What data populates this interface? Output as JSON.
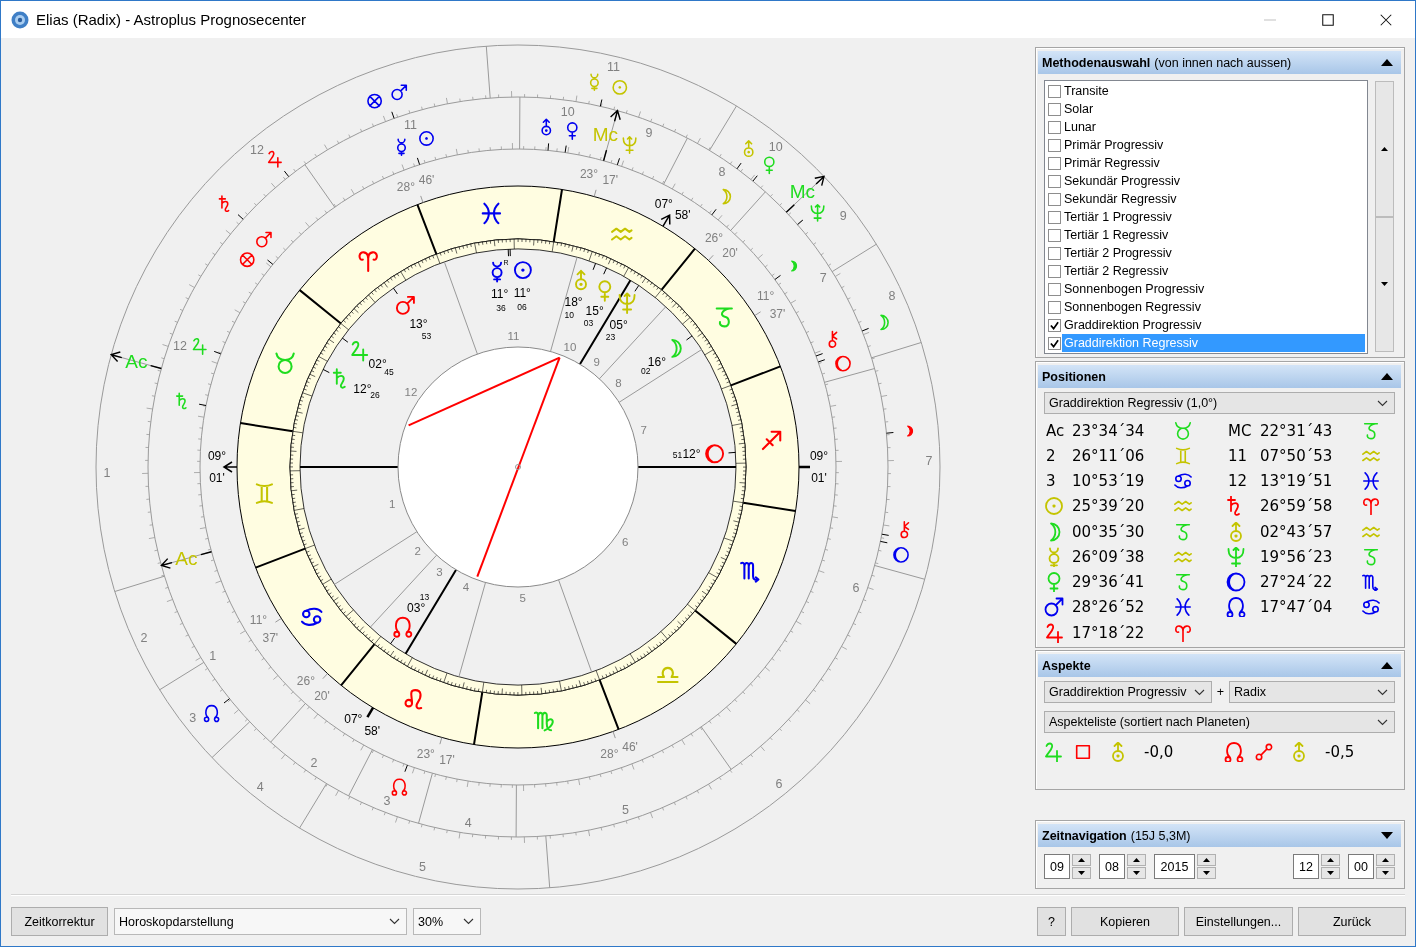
{
  "window": {
    "title": "Elias (Radix) - Astroplus Prognosecenter",
    "controls": [
      {
        "kind": "minimize",
        "disabled": true
      },
      {
        "kind": "maximize",
        "disabled": false
      },
      {
        "kind": "close",
        "disabled": false
      }
    ]
  },
  "wheel": {
    "signs": [
      {
        "kind": "aries",
        "color": "#ff0000"
      },
      {
        "kind": "taurus",
        "color": "#1fdc1f"
      },
      {
        "kind": "gemini",
        "color": "#c4c400"
      },
      {
        "kind": "cancer",
        "color": "#0000f0"
      },
      {
        "kind": "leo",
        "color": "#ff0000"
      },
      {
        "kind": "virgo",
        "color": "#1fdc1f"
      },
      {
        "kind": "libra",
        "color": "#c4c400"
      },
      {
        "kind": "scorpio",
        "color": "#0000f0"
      },
      {
        "kind": "sagittarius",
        "color": "#ff0000"
      },
      {
        "kind": "capricorn",
        "color": "#1fdc1f"
      },
      {
        "kind": "aquarius",
        "color": "#c4c400"
      },
      {
        "kind": "pisces",
        "color": "#0000f0"
      }
    ],
    "cusps": [
      {
        "kind": "cusp",
        "sign": {
          "kind": "pisces"
        },
        "degree": "28°",
        "minute": "46'"
      },
      {
        "kind": "cusp",
        "sign": {
          "kind": "aquarius"
        },
        "degree": "23°",
        "minute": "17'"
      },
      {
        "kind": "mc",
        "sign": {
          "kind": "aquarius"
        },
        "degree": "07°",
        "minute": "58'"
      },
      {
        "kind": "cusp",
        "sign": {
          "kind": "capricorn"
        },
        "degree": "26°",
        "minute": "20'"
      },
      {
        "kind": "cusp",
        "sign": {
          "kind": "capricorn"
        },
        "degree": "11°",
        "minute": "37'"
      },
      {
        "kind": "ac",
        "sign": {
          "kind": "gemini"
        },
        "degree": "09°",
        "minute": "01'"
      },
      {
        "kind": "dc",
        "sign": {
          "kind": "sagittarius"
        },
        "degree": "09°",
        "minute": "01'"
      },
      {
        "kind": "cusp",
        "sign": {
          "kind": "cancer"
        },
        "degree": "11°",
        "minute": "37'"
      },
      {
        "kind": "cusp",
        "sign": {
          "kind": "cancer"
        },
        "degree": "26°",
        "minute": "20'"
      },
      {
        "kind": "ic",
        "sign": {
          "kind": "leo"
        },
        "degree": "07°",
        "minute": "58'"
      },
      {
        "kind": "cusp",
        "sign": {
          "kind": "leo"
        },
        "degree": "23°",
        "minute": "17'"
      },
      {
        "kind": "cusp",
        "sign": {
          "kind": "virgo"
        },
        "degree": "28°",
        "minute": "46'"
      }
    ],
    "house_numbers": [
      "1",
      "2",
      "3",
      "4",
      "5",
      "6",
      "7",
      "8",
      "9",
      "10",
      "11",
      "12"
    ],
    "planets": [
      {
        "kind": "mercury",
        "sign": {
          "kind": "pisces"
        },
        "degree": "11°",
        "minute": "36",
        "retrograde": "R",
        "color": "#0000f0"
      },
      {
        "kind": "sun",
        "sign": {
          "kind": "pisces"
        },
        "degree": "11°",
        "minute": "06",
        "color": "#0000f0"
      },
      {
        "kind": "uranus",
        "sign": {
          "kind": "aquarius"
        },
        "degree": "18°",
        "minute": "10",
        "color": "#c4c400"
      },
      {
        "kind": "venus",
        "sign": {
          "kind": "aquarius"
        },
        "degree": "15°",
        "minute": "03",
        "color": "#c4c400"
      },
      {
        "kind": "mars",
        "sign": {
          "kind": "aries"
        },
        "degree": "13°",
        "minute": "53",
        "color": "#ff0000"
      },
      {
        "kind": "neptune",
        "sign": {
          "kind": "aquarius"
        },
        "degree": "05°",
        "minute": "23",
        "color": "#c4c400"
      },
      {
        "kind": "jupiter",
        "sign": {
          "kind": "taurus"
        },
        "degree": "02°",
        "minute": "45",
        "color": "#1fdc1f"
      },
      {
        "kind": "moon",
        "sign": {
          "kind": "capricorn"
        },
        "degree": "16°",
        "minute": "02",
        "color": "#1fdc1f"
      },
      {
        "kind": "saturn",
        "sign": {
          "kind": "taurus"
        },
        "degree": "12°",
        "minute": "26",
        "color": "#1fdc1f"
      },
      {
        "kind": "ringed_moon",
        "sign": {
          "kind": "sagittarius"
        },
        "degree": "12°",
        "minute": "51",
        "color": "#ff0000"
      },
      {
        "kind": "node",
        "sign": {
          "kind": "leo"
        },
        "degree": "03°",
        "minute": "13",
        "color": "#ff0000"
      }
    ],
    "rings": [
      {
        "houses": [
          "1",
          "2",
          "3",
          "4",
          "5",
          "6",
          "7",
          "8",
          "9",
          "10",
          "11",
          "12"
        ],
        "axes": [
          {
            "kind": "ac",
            "label": "Ac",
            "color": "#c4c400"
          },
          {
            "kind": "mc",
            "label": "Mc",
            "color": "#c4c400"
          }
        ],
        "points": [
          {
            "kind": "fortune",
            "color": "#ff0000"
          },
          {
            "kind": "mars",
            "color": "#ff0000"
          },
          {
            "kind": "jupiter",
            "color": "#1fdc1f"
          },
          {
            "kind": "saturn",
            "color": "#1fdc1f"
          },
          {
            "kind": "mercury",
            "color": "#0000f0"
          },
          {
            "kind": "sun",
            "color": "#0000f0"
          },
          {
            "kind": "uranus",
            "color": "#0000f0"
          },
          {
            "kind": "venus",
            "color": "#0000f0"
          },
          {
            "kind": "neptune",
            "color": "#c4c400"
          },
          {
            "kind": "moon",
            "color": "#c4c400"
          },
          {
            "kind": "small_moon",
            "color": "#1fdc1f"
          },
          {
            "kind": "chiron",
            "color": "#ff0000"
          },
          {
            "kind": "ringed_moon",
            "color": "#ff0000"
          },
          {
            "kind": "node",
            "color": "#ff0000"
          }
        ]
      },
      {
        "houses": [
          "1",
          "2",
          "3",
          "4",
          "5",
          "6",
          "7",
          "8",
          "9",
          "10",
          "11",
          "12"
        ],
        "axes": [
          {
            "kind": "ac",
            "label": "Ac",
            "color": "#1fdc1f"
          },
          {
            "kind": "mc",
            "label": "Mc",
            "color": "#1fdc1f"
          }
        ],
        "points": [
          {
            "kind": "fortune",
            "color": "#0000f0"
          },
          {
            "kind": "mars",
            "color": "#0000f0"
          },
          {
            "kind": "jupiter",
            "color": "#ff0000"
          },
          {
            "kind": "saturn",
            "color": "#ff0000"
          },
          {
            "kind": "mercury",
            "color": "#c4c400"
          },
          {
            "kind": "sun",
            "color": "#c4c400"
          },
          {
            "kind": "uranus",
            "color": "#c4c400"
          },
          {
            "kind": "venus",
            "color": "#1fdc1f"
          },
          {
            "kind": "neptune",
            "color": "#1fdc1f"
          },
          {
            "kind": "moon",
            "color": "#1fdc1f"
          },
          {
            "kind": "small_moon",
            "color": "#ff0000"
          },
          {
            "kind": "chiron",
            "color": "#ff0000"
          },
          {
            "kind": "ringed_moon",
            "color": "#0000f0"
          },
          {
            "kind": "node",
            "color": "#0000f0"
          }
        ]
      }
    ]
  },
  "methods": {
    "title": "Methodenauswahl",
    "detail": "(von innen nach aussen)",
    "expanded": true,
    "items": [
      {
        "label": "Transite",
        "checked": false,
        "selected": false
      },
      {
        "label": "Solar",
        "checked": false,
        "selected": false
      },
      {
        "label": "Lunar",
        "checked": false,
        "selected": false
      },
      {
        "label": "Primär Progressiv",
        "checked": false,
        "selected": false
      },
      {
        "label": "Primär Regressiv",
        "checked": false,
        "selected": false
      },
      {
        "label": "Sekundär Progressiv",
        "checked": false,
        "selected": false
      },
      {
        "label": "Sekundär Regressiv",
        "checked": false,
        "selected": false
      },
      {
        "label": "Tertiär 1 Progressiv",
        "checked": false,
        "selected": false
      },
      {
        "label": "Tertiär 1 Regressiv",
        "checked": false,
        "selected": false
      },
      {
        "label": "Tertiär 2 Progressiv",
        "checked": false,
        "selected": false
      },
      {
        "label": "Tertiär 2 Regressiv",
        "checked": false,
        "selected": false
      },
      {
        "label": "Sonnenbogen Progressiv",
        "checked": false,
        "selected": false
      },
      {
        "label": "Sonnenbogen Regressiv",
        "checked": false,
        "selected": false
      },
      {
        "label": "Graddirektion Progressiv",
        "checked": true,
        "selected": false
      },
      {
        "label": "Graddirektion Regressiv",
        "checked": true,
        "selected": true
      }
    ]
  },
  "positions": {
    "title": "Positionen",
    "expanded": true,
    "method": "Graddirektion Regressiv (1,0°)",
    "columns": [
      [
        {
          "cells": [
            {
              "kind": "text",
              "text": "Ac"
            },
            {
              "kind": "text",
              "text": "23°34´34"
            },
            {
              "kind": "taurus",
              "color": "#1fdc1f"
            }
          ]
        },
        {
          "cells": [
            {
              "kind": "text",
              "text": "2"
            },
            {
              "kind": "text",
              "text": "26°11´06"
            },
            {
              "kind": "gemini",
              "color": "#c4c400"
            }
          ]
        },
        {
          "cells": [
            {
              "kind": "text",
              "text": "3"
            },
            {
              "kind": "text",
              "text": "10°53´19"
            },
            {
              "kind": "cancer",
              "color": "#0000f0"
            }
          ]
        },
        {
          "cells": [
            {
              "kind": "sun",
              "color": "#c4c400"
            },
            {
              "kind": "text",
              "text": "25°39´20"
            },
            {
              "kind": "aquarius",
              "color": "#c4c400"
            }
          ]
        },
        {
          "cells": [
            {
              "kind": "moon",
              "color": "#1fdc1f"
            },
            {
              "kind": "text",
              "text": "00°35´30"
            },
            {
              "kind": "capricorn",
              "color": "#1fdc1f"
            }
          ]
        },
        {
          "cells": [
            {
              "kind": "mercury",
              "color": "#c4c400"
            },
            {
              "kind": "text",
              "text": "26°09´38"
            },
            {
              "kind": "aquarius",
              "color": "#c4c400"
            }
          ]
        },
        {
          "cells": [
            {
              "kind": "venus",
              "color": "#1fdc1f"
            },
            {
              "kind": "text",
              "text": "29°36´41"
            },
            {
              "kind": "capricorn",
              "color": "#1fdc1f"
            }
          ]
        },
        {
          "cells": [
            {
              "kind": "mars",
              "color": "#0000f0"
            },
            {
              "kind": "text",
              "text": "28°26´52"
            },
            {
              "kind": "pisces",
              "color": "#0000f0"
            }
          ]
        },
        {
          "cells": [
            {
              "kind": "jupiter",
              "color": "#ff0000"
            },
            {
              "kind": "text",
              "text": "17°18´22"
            },
            {
              "kind": "aries",
              "color": "#ff0000"
            }
          ]
        }
      ],
      [
        {
          "cells": [
            {
              "kind": "text",
              "text": "MC"
            },
            {
              "kind": "text",
              "text": "22°31´43"
            },
            {
              "kind": "capricorn",
              "color": "#1fdc1f"
            }
          ]
        },
        {
          "cells": [
            {
              "kind": "text",
              "text": "11"
            },
            {
              "kind": "text",
              "text": "07°50´53"
            },
            {
              "kind": "aquarius",
              "color": "#c4c400"
            }
          ]
        },
        {
          "cells": [
            {
              "kind": "text",
              "text": "12"
            },
            {
              "kind": "text",
              "text": "13°19´51"
            },
            {
              "kind": "pisces",
              "color": "#0000f0"
            }
          ]
        },
        {
          "cells": [
            {
              "kind": "saturn",
              "color": "#ff0000"
            },
            {
              "kind": "text",
              "text": "26°59´58"
            },
            {
              "kind": "aries",
              "color": "#ff0000"
            }
          ]
        },
        {
          "cells": [
            {
              "kind": "uranus",
              "color": "#c4c400"
            },
            {
              "kind": "text",
              "text": "02°43´57"
            },
            {
              "kind": "aquarius",
              "color": "#c4c400"
            }
          ]
        },
        {
          "cells": [
            {
              "kind": "neptune",
              "color": "#1fdc1f"
            },
            {
              "kind": "text",
              "text": "19°56´23"
            },
            {
              "kind": "capricorn",
              "color": "#1fdc1f"
            }
          ]
        },
        {
          "cells": [
            {
              "kind": "ringed_moon",
              "color": "#0000f0"
            },
            {
              "kind": "text",
              "text": "27°24´22"
            },
            {
              "kind": "scorpio",
              "color": "#0000f0"
            }
          ]
        },
        {
          "cells": [
            {
              "kind": "node",
              "color": "#0000f0"
            },
            {
              "kind": "text",
              "text": "17°47´04"
            },
            {
              "kind": "cancer",
              "color": "#0000f0"
            }
          ]
        }
      ]
    ]
  },
  "aspects": {
    "title": "Aspekte",
    "expanded": true,
    "left_method": "Graddirektion Progressiv",
    "joiner": "+",
    "right_method": "Radix",
    "list_type": "Aspekteliste (sortiert nach Planeten)",
    "items": [
      {
        "cells": [
          {
            "kind": "jupiter",
            "color": "#1fdc1f"
          },
          {
            "kind": "square",
            "color": "#ff0000"
          },
          {
            "kind": "uranus",
            "color": "#c4c400"
          },
          {
            "kind": "text",
            "text": "-0,0"
          }
        ]
      },
      {
        "cells": [
          {
            "kind": "node",
            "color": "#ff0000"
          },
          {
            "kind": "opposition",
            "color": "#ff0000"
          },
          {
            "kind": "uranus",
            "color": "#c4c400"
          },
          {
            "kind": "text",
            "text": "-0,5"
          }
        ]
      }
    ]
  },
  "time_navigation": {
    "title": "Zeitnavigation",
    "detail": "(15J 5,3M)",
    "expanded": false,
    "date": [
      "09",
      "08",
      "2015"
    ],
    "time": [
      "12",
      "00"
    ]
  },
  "toolbar": {
    "left": [
      {
        "kind": "button",
        "label": "Zeitkorrektur"
      },
      {
        "kind": "dropdown",
        "label": "Horoskopdarstellung"
      },
      {
        "kind": "dropdown",
        "label": "30%"
      }
    ],
    "right": [
      {
        "kind": "button",
        "label": "?"
      },
      {
        "kind": "button",
        "label": "Kopieren"
      },
      {
        "kind": "button",
        "label": "Einstellungen..."
      },
      {
        "kind": "button",
        "label": "Zurück"
      }
    ]
  }
}
